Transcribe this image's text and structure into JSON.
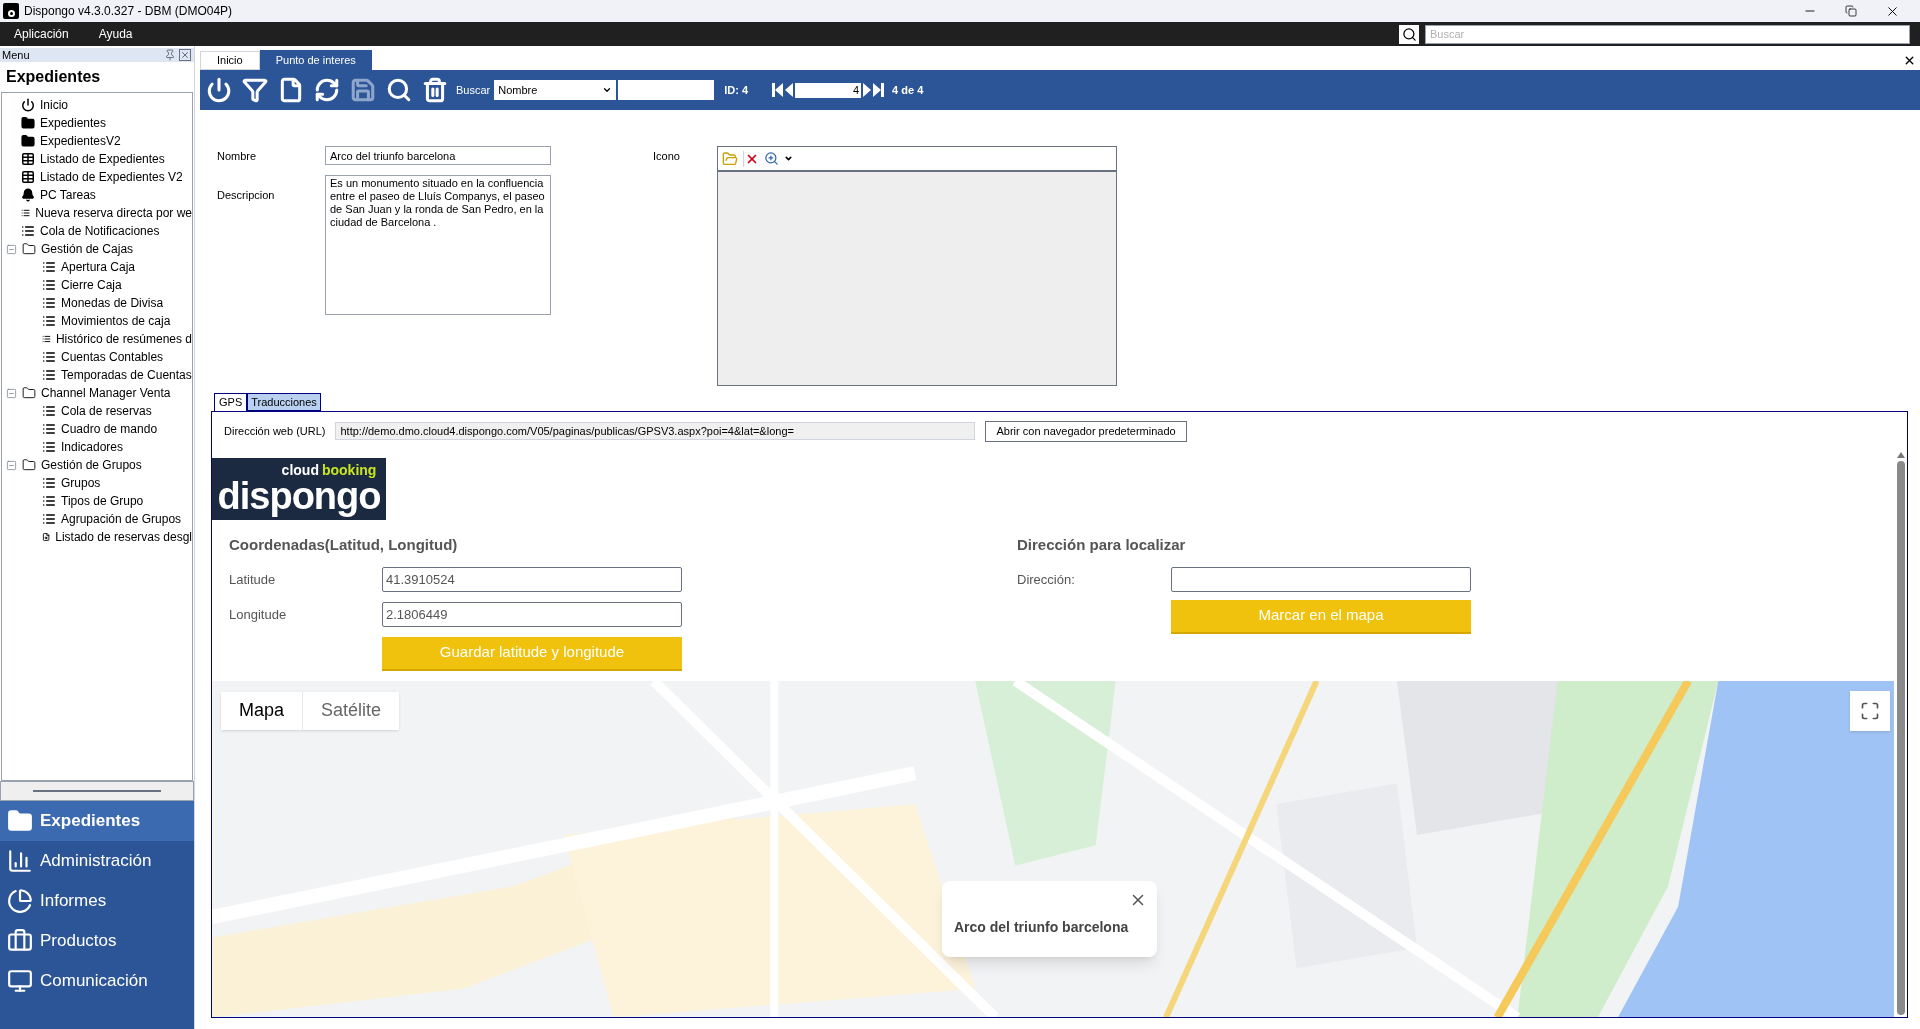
{
  "window": {
    "title": "Dispongo v4.3.0.327 - DBM (DMO04P)"
  },
  "menu_bar": {
    "items": [
      "Aplicación",
      "Ayuda"
    ],
    "search": {
      "placeholder": "Buscar"
    }
  },
  "sidebar": {
    "header": "Menu",
    "title": "Expedientes",
    "tree": [
      {
        "label": "Inicio",
        "kind": "power"
      },
      {
        "label": "Expedientes",
        "kind": "folder"
      },
      {
        "label": "ExpedientesV2",
        "kind": "folder"
      },
      {
        "label": "Listado de Expedientes",
        "kind": "table"
      },
      {
        "label": "Listado de Expedientes V2",
        "kind": "table"
      },
      {
        "label": "PC Tareas",
        "kind": "bell"
      },
      {
        "label": "Nueva reserva directa por we",
        "kind": "list"
      },
      {
        "label": "Cola de Notificaciones",
        "kind": "list"
      },
      {
        "label": "Gestión de Cajas",
        "kind": "group",
        "expanded": true,
        "children": [
          {
            "label": "Apertura Caja",
            "kind": "list"
          },
          {
            "label": "Cierre Caja",
            "kind": "list"
          },
          {
            "label": "Monedas de Divisa",
            "kind": "list"
          },
          {
            "label": "Movimientos de caja",
            "kind": "list"
          },
          {
            "label": "Histórico de resúmenes d",
            "kind": "list"
          },
          {
            "label": "Cuentas Contables",
            "kind": "list"
          },
          {
            "label": "Temporadas de Cuentas",
            "kind": "list"
          }
        ]
      },
      {
        "label": "Channel Manager Venta",
        "kind": "group",
        "expanded": true,
        "children": [
          {
            "label": "Cola de reservas",
            "kind": "list"
          },
          {
            "label": "Cuadro de mando",
            "kind": "list"
          },
          {
            "label": "Indicadores",
            "kind": "list"
          }
        ]
      },
      {
        "label": "Gestión de Grupos",
        "kind": "group",
        "expanded": true,
        "children": [
          {
            "label": "Grupos",
            "kind": "list"
          },
          {
            "label": "Tipos de Grupo",
            "kind": "list"
          },
          {
            "label": "Agrupación de Grupos",
            "kind": "list"
          },
          {
            "label": "Listado de reservas desgl",
            "kind": "search-doc"
          }
        ]
      }
    ],
    "nav": [
      {
        "label": "Expedientes",
        "kind": "folder",
        "selected": true
      },
      {
        "label": "Administración",
        "kind": "chart",
        "selected": false
      },
      {
        "label": "Informes",
        "kind": "pie",
        "selected": false
      },
      {
        "label": "Productos",
        "kind": "briefcase",
        "selected": false
      },
      {
        "label": "Comunicación",
        "kind": "monitor",
        "selected": false
      }
    ]
  },
  "tabs": [
    {
      "label": "Inicio",
      "selected": false
    },
    {
      "label": "Punto de interes",
      "selected": true
    }
  ],
  "toolbar": {
    "buttons": [
      {
        "kind": "power",
        "disabled": false
      },
      {
        "kind": "filter",
        "disabled": false
      },
      {
        "kind": "new",
        "disabled": false
      },
      {
        "kind": "refresh",
        "disabled": false
      },
      {
        "kind": "save",
        "disabled": true
      },
      {
        "kind": "search",
        "disabled": false
      },
      {
        "kind": "delete",
        "disabled": false
      }
    ],
    "search_label": "Buscar",
    "search_field": "Nombre",
    "id": "ID: 4",
    "page": "4",
    "page_count": "4 de 4"
  },
  "form": {
    "name_label": "Nombre",
    "name": "Arco del triunfo barcelona",
    "description_label": "Descripcion",
    "description": "Es un monumento situado en la confluencia entre el paseo de Lluís Companys, el paseo de San Juan y la ronda de San Pedro, en la ciudad de Barcelona .",
    "icon_label": "Icono"
  },
  "sub_tabs": [
    {
      "label": "GPS",
      "selected": true
    },
    {
      "label": "Traducciones",
      "selected": false
    }
  ],
  "gps": {
    "url_label": "Dirección web (URL)",
    "url": "http://demo.dmo.cloud4.dispongo.com/V05/paginas/publicas/GPSV3.aspx?poi=4&lat=&long=",
    "open_button": "Abrir con navegador predeterminado",
    "logo": {
      "top_left": "cloud",
      "top_right": "booking",
      "main": "dispongo"
    },
    "coords_title": "Coordenadas(Latitud, Longitud)",
    "latitude_label": "Latitude",
    "latitude": "41.3910524",
    "longitude_label": "Longitude",
    "longitude": "2.1806449",
    "save_button": "Guardar latitude y longitude",
    "address_title": "Dirección para localizar",
    "address_label": "Dirección:",
    "mark_button": "Marcar en el mapa"
  },
  "map": {
    "kind": "picture",
    "map_types": [
      {
        "label": "Mapa",
        "selected": true
      },
      {
        "label": "Satélite",
        "selected": false
      }
    ],
    "popup": {
      "title": "Arco del triunfo barcelona"
    }
  }
}
